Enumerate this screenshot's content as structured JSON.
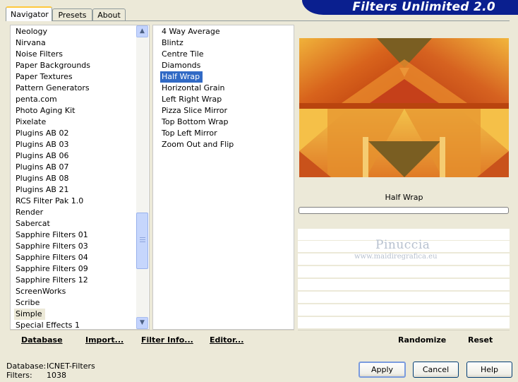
{
  "header": {
    "title": "Filters Unlimited 2.0"
  },
  "tabs": [
    {
      "label": "Navigator",
      "active": true
    },
    {
      "label": "Presets",
      "active": false
    },
    {
      "label": "About",
      "active": false
    }
  ],
  "categories": {
    "items": [
      "Neology",
      "Nirvana",
      "Noise Filters",
      "Paper Backgrounds",
      "Paper Textures",
      "Pattern Generators",
      "penta.com",
      "Photo Aging Kit",
      "Pixelate",
      "Plugins AB 02",
      "Plugins AB 03",
      "Plugins AB 06",
      "Plugins AB 07",
      "Plugins AB 08",
      "Plugins AB 21",
      "RCS Filter Pak 1.0",
      "Render",
      "Sabercat",
      "Sapphire Filters 01",
      "Sapphire Filters 03",
      "Sapphire Filters 04",
      "Sapphire Filters 09",
      "Sapphire Filters 12",
      "ScreenWorks",
      "Scribe",
      "Simple",
      "Special Effects 1"
    ],
    "selected": "Simple"
  },
  "filters": {
    "items": [
      "4 Way Average",
      "Blintz",
      "Centre Tile",
      "Diamonds",
      "Half Wrap",
      "Horizontal Grain",
      "Left Right Wrap",
      "Pizza Slice Mirror",
      "Top Bottom Wrap",
      "Top Left Mirror",
      "Zoom Out and Flip"
    ],
    "selected": "Half Wrap"
  },
  "left_toolbar": {
    "database": "Database",
    "import": "Import...",
    "filter_info": "Filter Info...",
    "editor": "Editor..."
  },
  "right_toolbar": {
    "randomize": "Randomize",
    "reset": "Reset"
  },
  "preview": {
    "filter_name": "Half Wrap",
    "progress": 0
  },
  "watermark": {
    "name": "Pinuccia",
    "url": "www.maidiregrafica.eu"
  },
  "status": {
    "database_label": "Database:",
    "database_value": "ICNET-Filters",
    "filters_label": "Filters:",
    "filters_value": "1038"
  },
  "buttons": {
    "apply": "Apply",
    "cancel": "Cancel",
    "help": "Help"
  },
  "colors": {
    "title_bar": "#0a1f8f",
    "selection": "#316ac5",
    "dialog_bg": "#ece9d8"
  }
}
